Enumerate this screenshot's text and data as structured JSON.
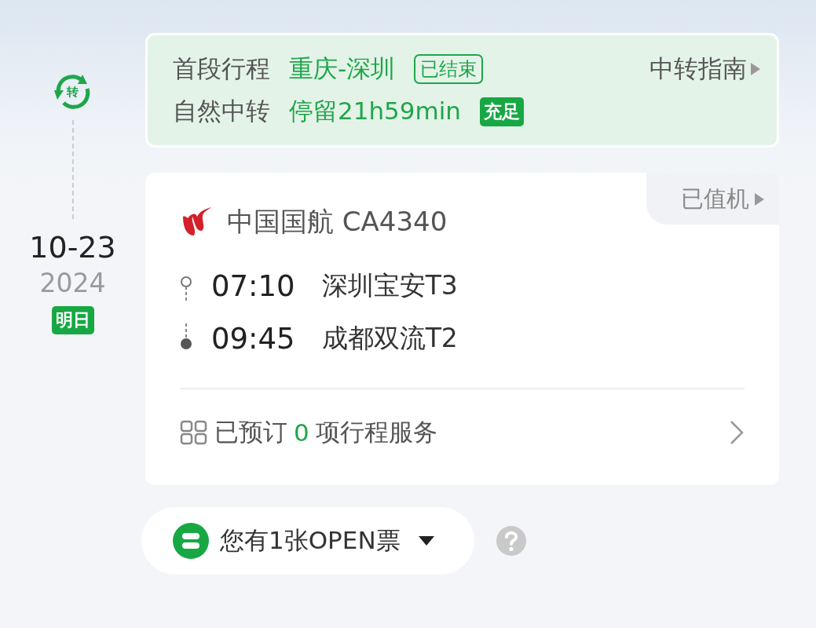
{
  "transfer": {
    "icon_text": "转",
    "first_leg_label": "首段行程",
    "first_leg_route": "重庆-深圳",
    "first_leg_status": "已结束",
    "guide_link": "中转指南",
    "transfer_label": "自然中转",
    "stay": "停留21h59min",
    "stay_badge": "充足"
  },
  "date": {
    "day": "10-23",
    "year": "2024",
    "badge": "明日"
  },
  "flight": {
    "airline": "中国国航 CA4340",
    "checkin": "已值机",
    "segments": [
      {
        "time": "07:10",
        "airport": "深圳宝安T3",
        "kind": "departure"
      },
      {
        "time": "09:45",
        "airport": "成都双流T2",
        "kind": "arrival"
      }
    ],
    "services": {
      "prefix": "已预订",
      "count": "0",
      "suffix": "项行程服务"
    }
  },
  "open_ticket": {
    "label": "您有1张OPEN票"
  }
}
